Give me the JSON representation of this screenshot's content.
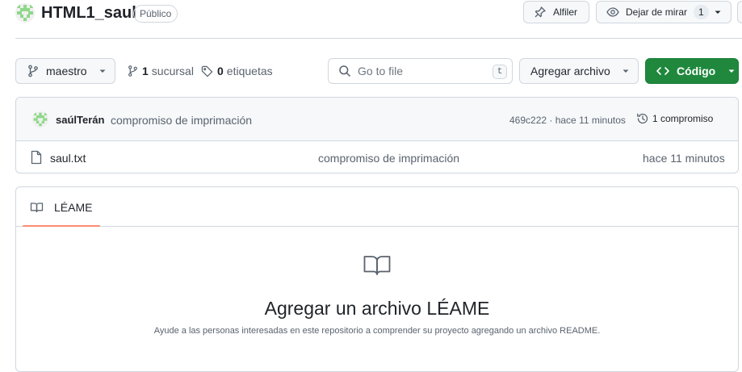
{
  "repo": {
    "name": "HTML1_saul",
    "visibility": "Público",
    "pin_label": "Alfiler",
    "watch_label": "Dejar de mirar",
    "watch_count": "1"
  },
  "toolbar": {
    "branch": "maestro",
    "branches_count": "1",
    "branches_label": "sucursal",
    "tags_count": "0",
    "tags_label": "etiquetas",
    "search_placeholder": "Go to file",
    "search_shortcut": "t",
    "add_file_label": "Agregar archivo",
    "code_label": "Código"
  },
  "latest_commit": {
    "author": "saúlTerán",
    "message": "compromiso de imprimación",
    "meta": "469c222 · hace 11 minutos",
    "history_label": "1 compromiso"
  },
  "files": [
    {
      "name": "saul.txt",
      "commit_message": "compromiso de imprimación",
      "time": "hace 11 minutos"
    }
  ],
  "readme": {
    "tab_label": "LÉAME",
    "heading": "Agregar un archivo LÉAME",
    "description": "Ayude a las personas interesadas en este repositorio a comprender su proyecto agregando un archivo README."
  },
  "icons": {
    "avatar": "identicon-avatar",
    "pin": "pin-icon",
    "watch": "eye-icon",
    "branch": "git-branch-icon",
    "tag": "tag-icon",
    "search": "search-icon",
    "code": "code-icon",
    "history": "history-icon",
    "file": "file-icon",
    "book": "book-icon"
  },
  "colors": {
    "accent_green": "#1f883d",
    "avatar_green": "#8ed889",
    "tab_underline": "#fd8c73",
    "border": "#d0d7de",
    "muted_text": "#59636e"
  }
}
